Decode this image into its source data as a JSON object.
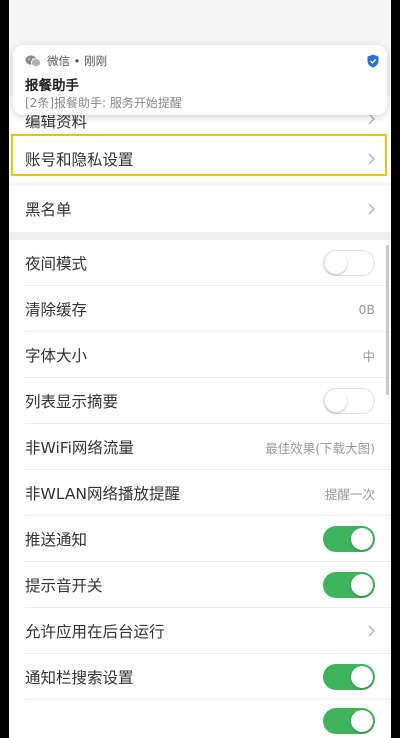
{
  "notification": {
    "app_line": "微信 • 刚刚",
    "title": "报餐助手",
    "body": "[2条]报餐助手: 服务开始提醒"
  },
  "settings": {
    "partial_item": "编辑资料",
    "account_privacy": "账号和隐私设置",
    "blacklist": "黑名单",
    "night_mode": {
      "label": "夜间模式",
      "enabled": false
    },
    "clear_cache": {
      "label": "清除缓存",
      "value": "0B"
    },
    "font_size": {
      "label": "字体大小",
      "value": "中"
    },
    "list_summary": {
      "label": "列表显示摘要",
      "enabled": false
    },
    "non_wifi_traffic": {
      "label": "非WiFi网络流量",
      "value": "最佳效果(下载大图)"
    },
    "non_wlan_play": {
      "label": "非WLAN网络播放提醒",
      "value": "提醒一次"
    },
    "push_notify": {
      "label": "推送通知",
      "enabled": true
    },
    "sound_switch": {
      "label": "提示音开关",
      "enabled": true
    },
    "background_run": {
      "label": "允许应用在后台运行"
    },
    "notif_search": {
      "label": "通知栏搜索设置",
      "enabled": true
    }
  },
  "colors": {
    "toggle_on": "#3cb35c",
    "highlight": "#f5c000",
    "verified": "#2f6fe0"
  }
}
